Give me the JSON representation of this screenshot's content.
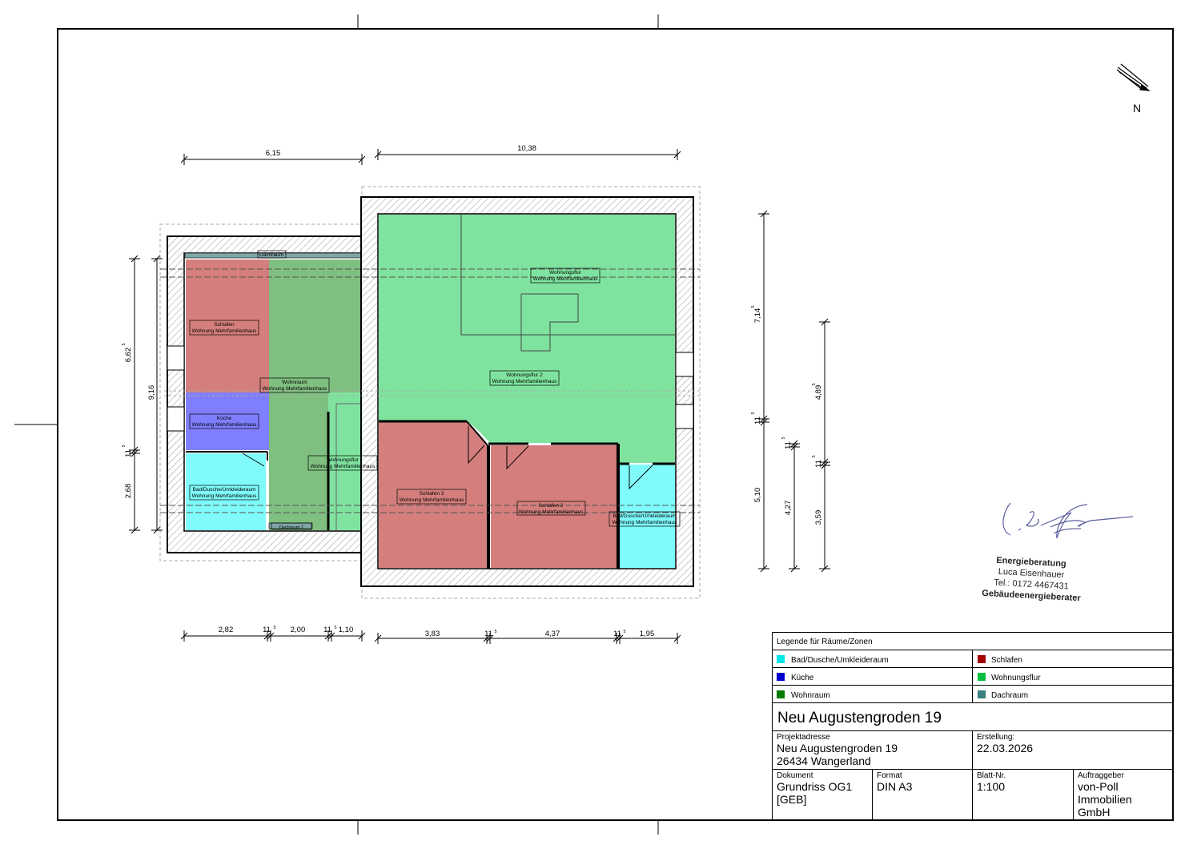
{
  "north_label": "N",
  "dimensions": {
    "top": [
      "6,15",
      "10,38"
    ],
    "bottom": [
      "2,82",
      "11",
      "5",
      "2,00",
      "11",
      "5",
      "1,10",
      "3,83",
      "11",
      "5",
      "4,37",
      "11",
      "5",
      "1,95"
    ],
    "left": [
      "6,62",
      "5",
      "9,16",
      "11",
      "5",
      "2,68"
    ],
    "right": [
      "7,14",
      "5",
      "11",
      "5",
      "5,10",
      "11",
      "5",
      "4,27",
      "4,89",
      "5",
      "11",
      "5",
      "3,59"
    ]
  },
  "rooms": [
    {
      "name": "Dachraum",
      "sub": ""
    },
    {
      "name": "Schlafen",
      "sub": "Wohnung Mehrfamilienhaus"
    },
    {
      "name": "Wohnraum",
      "sub": "Wohnung Mehrfamilienhaus"
    },
    {
      "name": "Küche",
      "sub": "Wohnung Mehrfamilienhaus"
    },
    {
      "name": "Bad/Dusche/Umkleideraum",
      "sub": "Wohnung Mehrfamilienhaus"
    },
    {
      "name": "Wohnungsflur",
      "sub": "Wohnung Mehrfamilienhaus"
    },
    {
      "name": "Dachraum 2",
      "sub": ""
    },
    {
      "name": "Wohnungsflur",
      "sub": "Wohnung Mehrfamilienhaus"
    },
    {
      "name": "Wohnungsflur 2",
      "sub": "Wohnung Mehrfamilienhaus"
    },
    {
      "name": "Schlafen 3",
      "sub": "Wohnung Mehrfamilienhaus"
    },
    {
      "name": "Schlafen 2",
      "sub": "Wohnung Mehrfamilienhaus"
    },
    {
      "name": "Bad/Dusche/Umkleideraum",
      "sub": "Wohnung Mehrfamilienhaus"
    }
  ],
  "colors": {
    "bad": "#7ffbfb",
    "schlafen": "#d47f7d",
    "kueche": "#7f7ffd",
    "wohnraum": "#7fbf7f",
    "flur": "#7fe39f",
    "dachraum": "#7fa6a6"
  },
  "legend": {
    "title": "Legende für Räume/Zonen",
    "items": [
      {
        "label": "Bad/Dusche/Umkleideraum",
        "color": "#00e5e5"
      },
      {
        "label": "Schlafen",
        "color": "#a40000"
      },
      {
        "label": "Küche",
        "color": "#0000cc"
      },
      {
        "label": "Wohnungsflur",
        "color": "#00c040"
      },
      {
        "label": "Wohnraum",
        "color": "#007a00"
      },
      {
        "label": "Dachraum",
        "color": "#3a8080"
      }
    ]
  },
  "titleblock": {
    "title": "Neu Augustengroden 19",
    "project_label": "Projektadresse",
    "project_line1": "Neu Augustengroden  19",
    "project_line2": "26434 Wangerland",
    "created_label": "Erstellung:",
    "created_value": "22.03.2026",
    "doc_label": "Dokument",
    "doc_value_1": "Grundriss OG1",
    "doc_value_2": "[GEB]",
    "format_label": "Format",
    "format_value": "DIN A3",
    "sheet_label": "Blatt-Nr.",
    "sheet_value": "1:100",
    "client_label": "Auftraggeber",
    "client_value_1": "von-Poll",
    "client_value_2": "Immobilien",
    "client_value_3": "GmbH"
  },
  "stamp": {
    "line1": "Energieberatung",
    "line2": "Luca Eisenhauer",
    "line3": "Tel.: 0172 4467431",
    "line4": "Gebäudeenergieberater"
  }
}
